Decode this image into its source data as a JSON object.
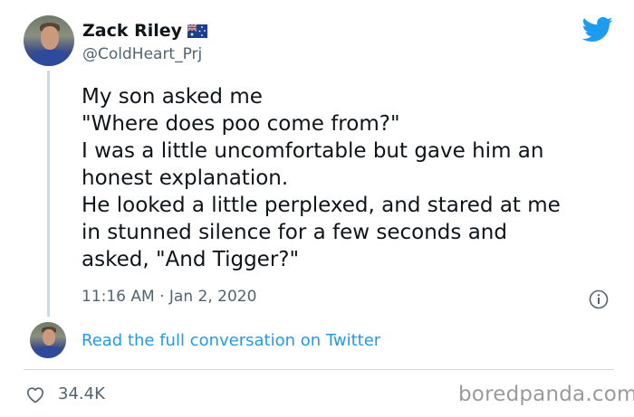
{
  "tweet": {
    "author_name": "Zack Riley",
    "author_handle": "@ColdHeart_Prj",
    "flag_icon": "australia-flag-icon",
    "platform_icon": "twitter-bird-icon",
    "lines": [
      "My son asked me",
      "\"Where does poo come from?\"",
      "I was a little uncomfortable but gave him an",
      "honest explanation.",
      "He looked a little perplexed, and stared at me",
      "in stunned silence for a few seconds and",
      "asked, \"And Tigger?\""
    ],
    "time": "11:16 AM · Jan 2, 2020",
    "read_more": "Read the full conversation on Twitter",
    "likes": "34.4K"
  },
  "watermark": "boredpanda.com",
  "colors": {
    "accent": "#1d9bf0",
    "secondary_text": "#536471",
    "divider": "#cfd9de"
  }
}
